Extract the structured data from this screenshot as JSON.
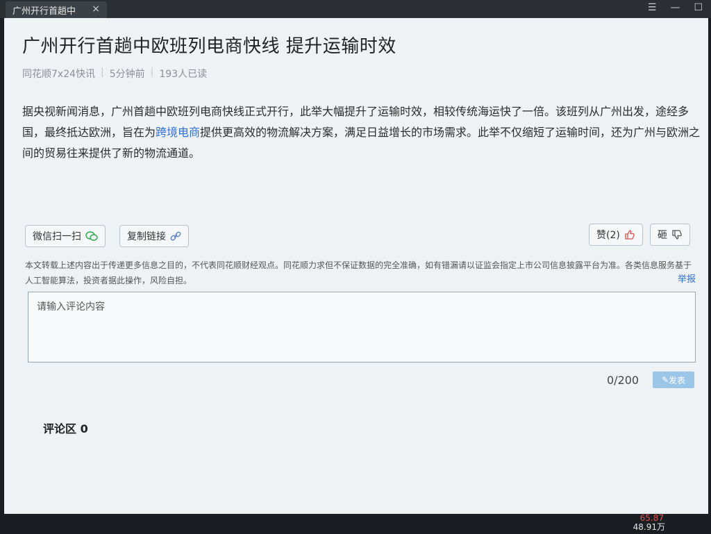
{
  "window": {
    "tab_title": "广州开行首趟中",
    "close_glyph": "×",
    "controls": {
      "list_icon": "☰",
      "minimize": "—",
      "maximize": "☐"
    }
  },
  "article": {
    "title": "广州开行首趟中欧班列电商快线 提升运输时效",
    "meta": {
      "source": "同花顺7x24快讯",
      "time": "5分钟前",
      "reads": "193人已读"
    },
    "body_part1": "据央视新闻消息，广州首趟中欧班列电商快线正式开行，此举大幅提升了运输时效，相较传统海运快了一倍。该班列从广州出发，途经多国，最终抵达欧洲，旨在为",
    "body_link": "跨境电商",
    "body_part2": "提供更高效的物流解决方案，满足日益增长的市场需求。此举不仅缩短了运输时间，还为广州与欧洲之间的贸易往来提供了新的物流通道。"
  },
  "actions": {
    "wechat_label": "微信扫一扫",
    "copy_label": "复制链接",
    "like_label": "赞(2)",
    "dislike_label": "砸"
  },
  "disclaimer": "本文转载上述内容出于传递更多信息之目的，不代表同花顺财经观点。同花顺力求但不保证数据的完全准确，如有错漏请以证监会指定上市公司信息披露平台为准。各类信息服务基于人工智能算法，投资者据此操作，风险自担。",
  "report_label": "举报",
  "comment": {
    "placeholder": "请输入评论内容",
    "counter": "0/200",
    "submit_label": "发表",
    "section_label": "评论区",
    "count": "0"
  },
  "ticker": {
    "value1": "65.87",
    "value2": "48.91万"
  },
  "colors": {
    "link": "#2f6fd6",
    "submit_bg": "#9cc6e8",
    "ticker_red": "#e05555"
  }
}
